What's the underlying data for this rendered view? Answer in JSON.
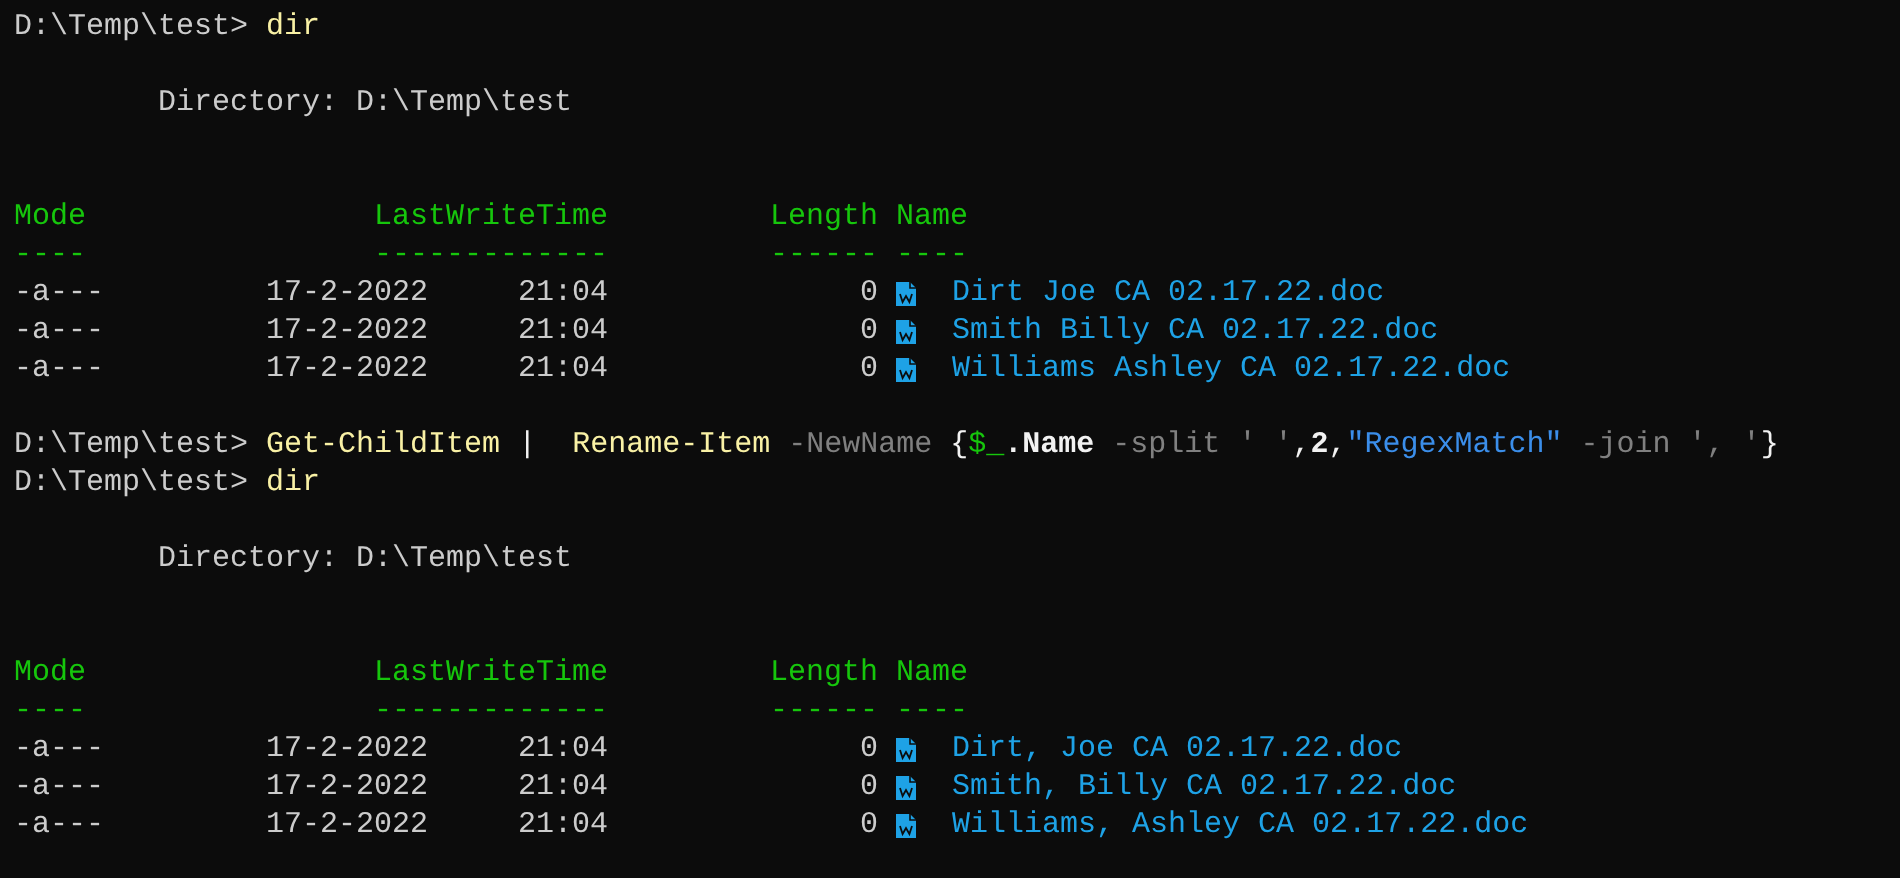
{
  "session": [
    {
      "kind": "command",
      "prompt": "D:\\Temp\\test>",
      "tokens": [
        {
          "text": "dir",
          "kind": "command"
        }
      ]
    },
    {
      "kind": "listing",
      "directory": "Directory: D:\\Temp\\test",
      "headers": [
        {
          "title": "Mode",
          "rule": "----"
        },
        {
          "title": "LastWriteTime",
          "rule": "-------------"
        },
        {
          "title": "Length",
          "rule": "------"
        },
        {
          "title": "Name",
          "rule": "----"
        }
      ],
      "rows": [
        {
          "mode": "-a---",
          "date": "17-2-2022",
          "time": "21:04",
          "length": "0",
          "name": "Dirt Joe CA 02.17.22.doc"
        },
        {
          "mode": "-a---",
          "date": "17-2-2022",
          "time": "21:04",
          "length": "0",
          "name": "Smith Billy CA 02.17.22.doc"
        },
        {
          "mode": "-a---",
          "date": "17-2-2022",
          "time": "21:04",
          "length": "0",
          "name": "Williams Ashley CA 02.17.22.doc"
        }
      ]
    },
    {
      "kind": "command",
      "prompt": "D:\\Temp\\test>",
      "tokens": [
        {
          "text": "Get-ChildItem",
          "kind": "command"
        },
        {
          "text": " |",
          "kind": "plain"
        },
        {
          "text": "  Rename-Item",
          "kind": "command"
        },
        {
          "text": " -NewName",
          "kind": "parameter"
        },
        {
          "text": " {",
          "kind": "plain"
        },
        {
          "text": "$_",
          "kind": "variable"
        },
        {
          "text": ".Name",
          "kind": "member"
        },
        {
          "text": " -split",
          "kind": "operator"
        },
        {
          "text": " ' '",
          "kind": "operator"
        },
        {
          "text": ",",
          "kind": "plain"
        },
        {
          "text": "2",
          "kind": "number"
        },
        {
          "text": ",",
          "kind": "plain"
        },
        {
          "text": "\"RegexMatch\"",
          "kind": "string"
        },
        {
          "text": " -join",
          "kind": "operator"
        },
        {
          "text": " ', '",
          "kind": "operator"
        },
        {
          "text": "}",
          "kind": "plain"
        }
      ]
    },
    {
      "kind": "command",
      "prompt": "D:\\Temp\\test>",
      "tokens": [
        {
          "text": "dir",
          "kind": "command"
        }
      ]
    },
    {
      "kind": "listing",
      "directory": "Directory: D:\\Temp\\test",
      "headers": [
        {
          "title": "Mode",
          "rule": "----"
        },
        {
          "title": "LastWriteTime",
          "rule": "-------------"
        },
        {
          "title": "Length",
          "rule": "------"
        },
        {
          "title": "Name",
          "rule": "----"
        }
      ],
      "rows": [
        {
          "mode": "-a---",
          "date": "17-2-2022",
          "time": "21:04",
          "length": "0",
          "name": "Dirt, Joe CA 02.17.22.doc"
        },
        {
          "mode": "-a---",
          "date": "17-2-2022",
          "time": "21:04",
          "length": "0",
          "name": "Smith, Billy CA 02.17.22.doc"
        },
        {
          "mode": "-a---",
          "date": "17-2-2022",
          "time": "21:04",
          "length": "0",
          "name": "Williams, Ashley CA 02.17.22.doc"
        }
      ]
    }
  ]
}
